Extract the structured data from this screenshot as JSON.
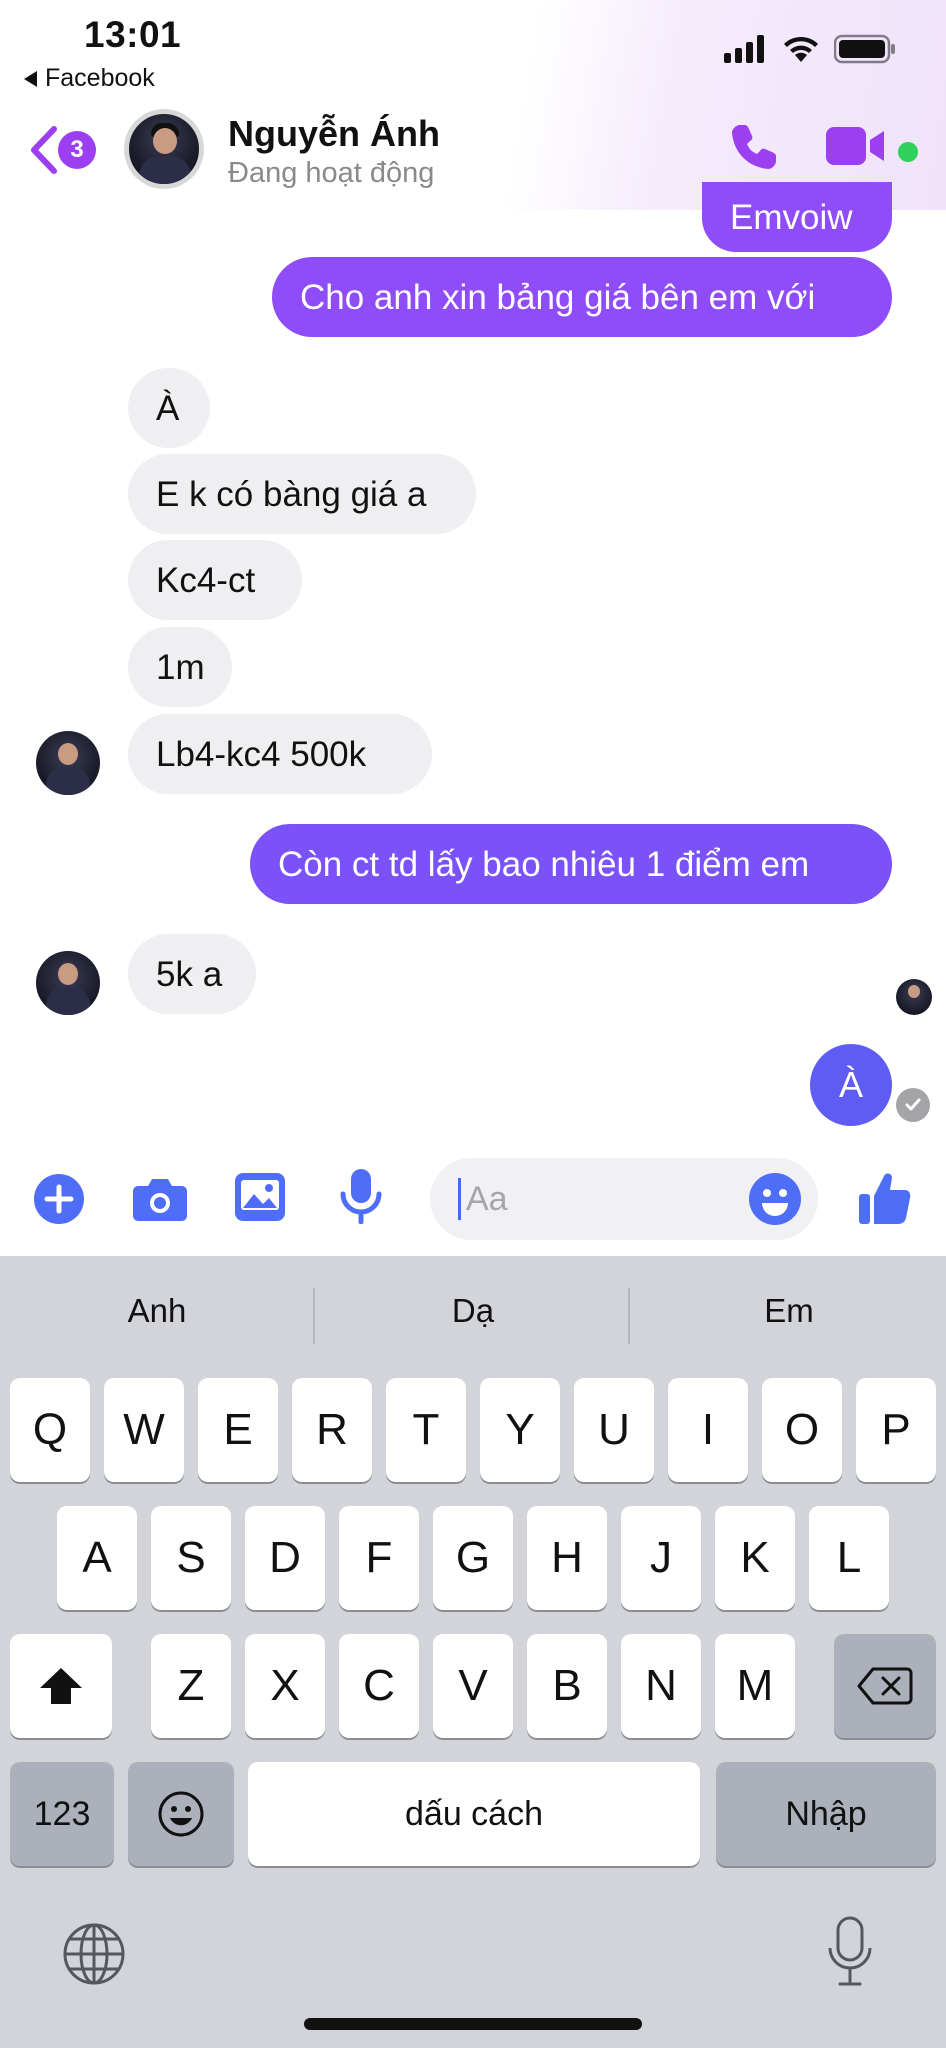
{
  "status_bar": {
    "time": "13:01",
    "back_app_label": "Facebook",
    "icons": [
      "signal-icon",
      "wifi-icon",
      "battery-icon"
    ]
  },
  "header": {
    "unread_count": "3",
    "contact_name": "Nguyễn Ánh",
    "contact_status": "Đang hoạt động",
    "icons": [
      "back-chevron-icon",
      "phone-icon",
      "video-camera-icon"
    ],
    "online_color": "#2fd05c"
  },
  "messages": [
    {
      "sender": "me",
      "text": "Emvoiw"
    },
    {
      "sender": "me",
      "text": "Cho anh xin bảng giá bên em với"
    },
    {
      "sender": "them",
      "text": "À"
    },
    {
      "sender": "them",
      "text": "E k có bàng giá a"
    },
    {
      "sender": "them",
      "text": "Kc4-ct"
    },
    {
      "sender": "them",
      "text": "1m"
    },
    {
      "sender": "them",
      "text": "Lb4-kc4 500k"
    },
    {
      "sender": "me",
      "text": "Còn ct td lấy bao nhiêu 1 điểm em"
    },
    {
      "sender": "them",
      "text": "5k a"
    },
    {
      "sender": "me",
      "text": "À",
      "state": "sending"
    }
  ],
  "composer": {
    "placeholder": "Aa",
    "icons": [
      "plus-icon",
      "camera-icon",
      "image-icon",
      "microphone-icon",
      "emoji-icon",
      "thumbs-up-icon"
    ]
  },
  "keyboard": {
    "suggestions": [
      "Anh",
      "Dạ",
      "Em"
    ],
    "row1": [
      "Q",
      "W",
      "E",
      "R",
      "T",
      "Y",
      "U",
      "I",
      "O",
      "P"
    ],
    "row2": [
      "A",
      "S",
      "D",
      "F",
      "G",
      "H",
      "J",
      "K",
      "L"
    ],
    "row3": [
      "Z",
      "X",
      "C",
      "V",
      "B",
      "N",
      "M"
    ],
    "numbers_key": "123",
    "space_key": "dấu cách",
    "return_key": "Nhập",
    "icons": [
      "shift-icon",
      "backspace-icon",
      "emoji-key-icon",
      "globe-icon",
      "dictation-microphone-icon"
    ]
  },
  "colors": {
    "accent": "#8e4df8",
    "accent_blue": "#5e5cf2",
    "incoming_bubble": "#efeff1"
  }
}
